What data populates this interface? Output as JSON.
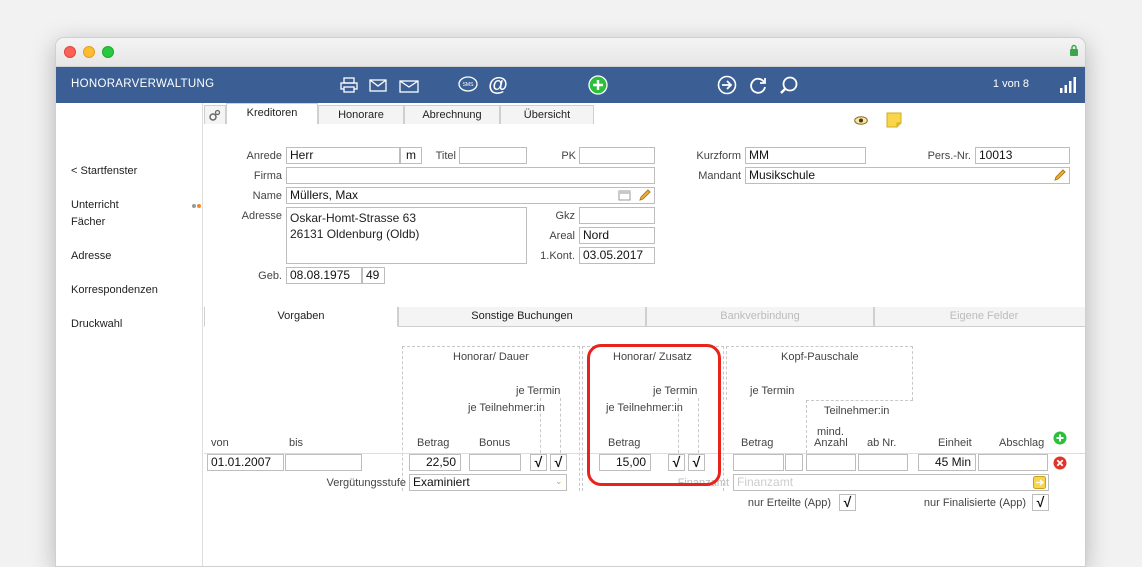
{
  "toolbar": {
    "title": "HONORARVERWALTUNG",
    "counter": "1 von 8"
  },
  "sidebar": {
    "items": [
      "< Startfenster",
      "Unterricht",
      "Fächer",
      "Adresse",
      "Korrespondenzen",
      "Druckwahl"
    ]
  },
  "tabs": [
    "Kreditoren",
    "Honorare",
    "Abrechnung",
    "Übersicht"
  ],
  "form": {
    "anrede_label": "Anrede",
    "anrede": "Herr",
    "gender": "m",
    "titel_label": "Titel",
    "titel": "",
    "pk_label": "PK",
    "pk": "",
    "firma_label": "Firma",
    "firma": "",
    "name_label": "Name",
    "name": "Müllers, Max",
    "adresse_label": "Adresse",
    "adresse": "Oskar-Homt-Strasse 63\n26131 Oldenburg (Oldb)",
    "gkz_label": "Gkz",
    "gkz": "",
    "areal_label": "Areal",
    "areal": "Nord",
    "kont_label": "1.Kont.",
    "kont": "03.05.2017",
    "geb_label": "Geb.",
    "geb": "08.08.1975",
    "age": "49",
    "kurzform_label": "Kurzform",
    "kurzform": "MM",
    "persnr_label": "Pers.-Nr.",
    "persnr": "10013",
    "mandant_label": "Mandant",
    "mandant": "Musikschule"
  },
  "tabs2": [
    "Vorgaben",
    "Sonstige Buchungen",
    "Bankverbindung",
    "Eigene Felder"
  ],
  "grid": {
    "group_dauer": "Honorar/ Dauer",
    "group_zusatz": "Honorar/ Zusatz",
    "group_kopf": "Kopf-Pauschale",
    "je_termin": "je Termin",
    "je_teilnehmer": "je Teilnehmer:in",
    "teilnehmer": "Teilnehmer:in",
    "mind": "mind.",
    "col_von": "von",
    "col_bis": "bis",
    "col_betrag": "Betrag",
    "col_bonus": "Bonus",
    "col_anzahl": "Anzahl",
    "col_abnr": "ab Nr.",
    "col_einheit": "Einheit",
    "col_abschlag": "Abschlag",
    "row": {
      "von": "01.01.2007",
      "bis": "",
      "betrag1": "22,50",
      "bonus": "",
      "check": "√",
      "betrag2": "15,00",
      "einheit": "45 Min"
    },
    "verguetung_label": "Vergütungsstufe",
    "verguetung": "Examiniert",
    "finanzamt_label": "Finanzamt",
    "finanzamt_placeholder": "Finanzamt",
    "nur_erteilte": "nur Erteilte (App)",
    "nur_final": "nur Finalisierte (App)"
  }
}
